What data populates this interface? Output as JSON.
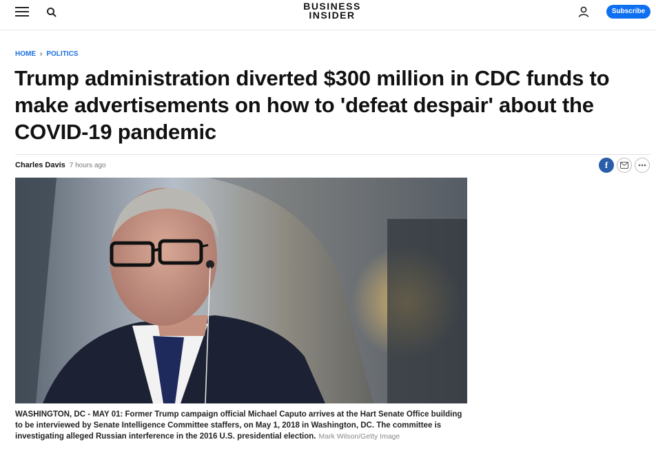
{
  "header": {
    "logo_line1": "BUSINESS",
    "logo_line2": "INSIDER",
    "subscribe_label": "Subscribe"
  },
  "breadcrumb": {
    "home": "HOME",
    "separator": "›",
    "section": "POLITICS"
  },
  "article": {
    "title": "Trump administration diverted $300 million in CDC funds to make advertisements on how to 'defeat despair' about the COVID-19 pandemic",
    "author": "Charles Davis",
    "timestamp": "7 hours ago",
    "caption": "WASHINGTON, DC - MAY 01: Former Trump campaign official Michael Caputo arrives at the Hart Senate Office building to be interviewed by Senate Intelligence Committee staffers, on May 1, 2018 in Washington, DC. The committee is investigating alleged Russian interference in the 2016 U.S. presidential election.",
    "credit": "Mark Wilson/Getty Image"
  },
  "share": {
    "facebook_glyph": "f",
    "icons": [
      "facebook-icon",
      "email-icon",
      "more-icon"
    ]
  },
  "colors": {
    "accent": "#0e6ff0",
    "breadcrumb": "#1a6fe0",
    "facebook": "#2b5ea8"
  }
}
